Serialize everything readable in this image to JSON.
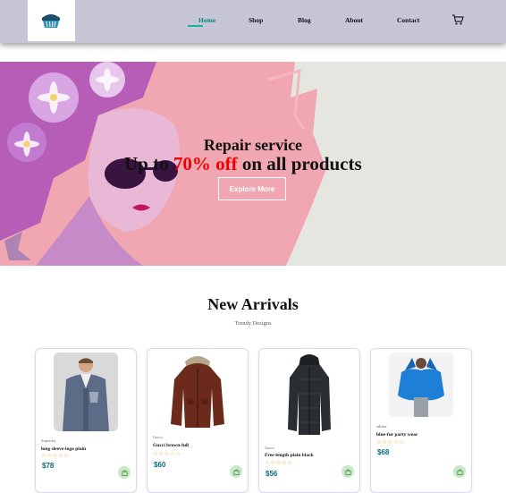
{
  "header": {
    "logo": "basket-logo",
    "nav": [
      {
        "label": "Home",
        "active": true
      },
      {
        "label": "Shop",
        "active": false
      },
      {
        "label": "Blog",
        "active": false
      },
      {
        "label": "About",
        "active": false
      },
      {
        "label": "Contact",
        "active": false
      }
    ],
    "cart_icon": "cart-icon",
    "active_color": "#0fb89a"
  },
  "hero": {
    "subtitle": "Repair service",
    "title_prefix": "Up to",
    "title_highlight": "70% off",
    "title_suffix": "on all products",
    "button_label": "Explore More",
    "highlight_color": "#f20000"
  },
  "arrivals": {
    "title": "New Arrivals",
    "subtitle": "Trendy Designs",
    "products": [
      {
        "brand": "Superdry",
        "name": "long sleeve-logo plain",
        "rating": "☆☆☆☆☆",
        "price": "$78",
        "image": "hoodie-man-photo"
      },
      {
        "brand": "Gucci",
        "name": "Gucci brown-full",
        "rating": "☆☆☆☆☆",
        "price": "$60",
        "image": "brown-parka-photo"
      },
      {
        "brand": "Gucci",
        "name": "Free-length plain black",
        "rating": "☆☆☆☆☆",
        "price": "$56",
        "image": "black-puffer-photo"
      },
      {
        "brand": "adidas",
        "name": "blue-fur party wear",
        "rating": "☆☆☆☆☆",
        "price": "$68",
        "image": "blue-fur-jacket-photo"
      }
    ]
  }
}
